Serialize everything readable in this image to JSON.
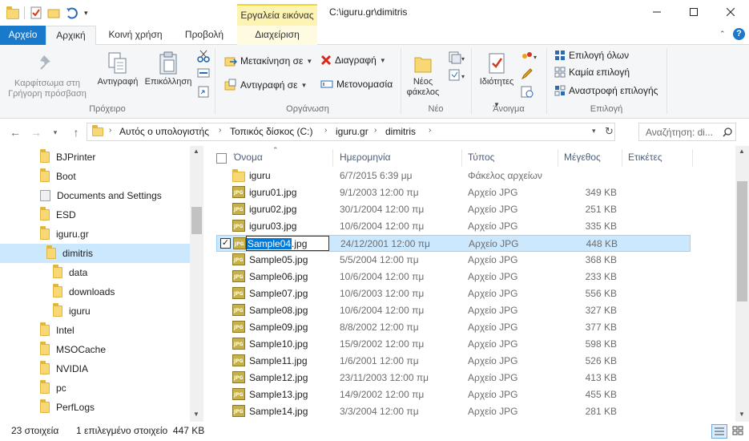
{
  "window": {
    "title": "C:\\iguru.gr\\dimitris",
    "context_tab_header": "Εργαλεία εικόνας"
  },
  "tabs": [
    "Αρχείο",
    "Αρχική",
    "Κοινή χρήση",
    "Προβολή",
    "Διαχείριση"
  ],
  "ribbon": {
    "clipboard": {
      "pin": "Καρφίτσωμα στη Γρήγορη πρόσβαση",
      "copy": "Αντιγραφή",
      "paste": "Επικόλληση",
      "label": "Πρόχειρο"
    },
    "organize": {
      "move_to": "Μετακίνηση σε",
      "copy_to": "Αντιγραφή σε",
      "delete": "Διαγραφή",
      "rename": "Μετονομασία",
      "label": "Οργάνωση"
    },
    "new": {
      "new_folder": "Νέος φάκελος",
      "label": "Νέο"
    },
    "open": {
      "properties": "Ιδιότητες",
      "label": "Άνοιγμα"
    },
    "select": {
      "select_all": "Επιλογή όλων",
      "select_none": "Καμία επιλογή",
      "invert": "Αναστροφή επιλογής",
      "label": "Επιλογή"
    }
  },
  "address": {
    "crumbs": [
      "Αυτός ο υπολογιστής",
      "Τοπικός δίσκος (C:)",
      "iguru.gr",
      "dimitris"
    ],
    "search_placeholder": "Αναζήτηση: di..."
  },
  "tree": [
    {
      "label": "BJPrinter",
      "icon": "folder-icon"
    },
    {
      "label": "Boot",
      "icon": "folder-icon"
    },
    {
      "label": "Documents and Settings",
      "icon": "shortcut-folder-icon"
    },
    {
      "label": "ESD",
      "icon": "folder-icon"
    },
    {
      "label": "iguru.gr",
      "icon": "folder-icon"
    },
    {
      "label": "dimitris",
      "icon": "folder-icon",
      "selected": true
    },
    {
      "label": "data",
      "icon": "folder-icon"
    },
    {
      "label": "downloads",
      "icon": "folder-icon"
    },
    {
      "label": "iguru",
      "icon": "folder-icon"
    },
    {
      "label": "Intel",
      "icon": "folder-icon"
    },
    {
      "label": "MSOCache",
      "icon": "folder-icon"
    },
    {
      "label": "NVIDIA",
      "icon": "folder-icon"
    },
    {
      "label": "pc",
      "icon": "folder-icon"
    },
    {
      "label": "PerfLogs",
      "icon": "folder-icon"
    }
  ],
  "columns": {
    "name": "Όνομα",
    "date": "Ημερομηνία",
    "type": "Τύπος",
    "size": "Μέγεθος",
    "tags": "Ετικέτες"
  },
  "files": [
    {
      "name": "iguru",
      "date": "6/7/2015 6:39 μμ",
      "type": "Φάκελος αρχείων",
      "size": "",
      "kind": "folder"
    },
    {
      "name": "iguru01.jpg",
      "date": "9/1/2003 12:00 πμ",
      "type": "Αρχείο JPG",
      "size": "349 KB",
      "kind": "jpg"
    },
    {
      "name": "iguru02.jpg",
      "date": "30/1/2004 12:00 πμ",
      "type": "Αρχείο JPG",
      "size": "251 KB",
      "kind": "jpg"
    },
    {
      "name": "iguru03.jpg",
      "date": "10/6/2004 12:00 πμ",
      "type": "Αρχείο JPG",
      "size": "335 KB",
      "kind": "jpg"
    },
    {
      "name": "Sample04.jpg",
      "date": "24/12/2001 12:00 πμ",
      "type": "Αρχείο JPG",
      "size": "448 KB",
      "kind": "jpg",
      "selected": true
    },
    {
      "name": "Sample05.jpg",
      "date": "5/5/2004 12:00 πμ",
      "type": "Αρχείο JPG",
      "size": "368 KB",
      "kind": "jpg"
    },
    {
      "name": "Sample06.jpg",
      "date": "10/6/2004 12:00 πμ",
      "type": "Αρχείο JPG",
      "size": "233 KB",
      "kind": "jpg"
    },
    {
      "name": "Sample07.jpg",
      "date": "10/6/2003 12:00 πμ",
      "type": "Αρχείο JPG",
      "size": "556 KB",
      "kind": "jpg"
    },
    {
      "name": "Sample08.jpg",
      "date": "10/6/2004 12:00 πμ",
      "type": "Αρχείο JPG",
      "size": "327 KB",
      "kind": "jpg"
    },
    {
      "name": "Sample09.jpg",
      "date": "8/8/2002 12:00 πμ",
      "type": "Αρχείο JPG",
      "size": "377 KB",
      "kind": "jpg"
    },
    {
      "name": "Sample10.jpg",
      "date": "15/9/2002 12:00 πμ",
      "type": "Αρχείο JPG",
      "size": "598 KB",
      "kind": "jpg"
    },
    {
      "name": "Sample11.jpg",
      "date": "1/6/2001 12:00 πμ",
      "type": "Αρχείο JPG",
      "size": "526 KB",
      "kind": "jpg"
    },
    {
      "name": "Sample12.jpg",
      "date": "23/11/2003 12:00 πμ",
      "type": "Αρχείο JPG",
      "size": "413 KB",
      "kind": "jpg"
    },
    {
      "name": "Sample13.jpg",
      "date": "14/9/2002 12:00 πμ",
      "type": "Αρχείο JPG",
      "size": "455 KB",
      "kind": "jpg"
    },
    {
      "name": "Sample14.jpg",
      "date": "3/3/2004 12:00 πμ",
      "type": "Αρχείο JPG",
      "size": "281 KB",
      "kind": "jpg"
    }
  ],
  "rename": {
    "selected_part": "Sample04",
    "extension": ".jpg"
  },
  "status": {
    "count": "23 στοιχεία",
    "selection": "1 επιλεγμένο στοιχείο  447 KB"
  },
  "colors": {
    "accent": "#1979ca",
    "selection": "#cce8ff",
    "context_tab": "#fdf3b3"
  }
}
